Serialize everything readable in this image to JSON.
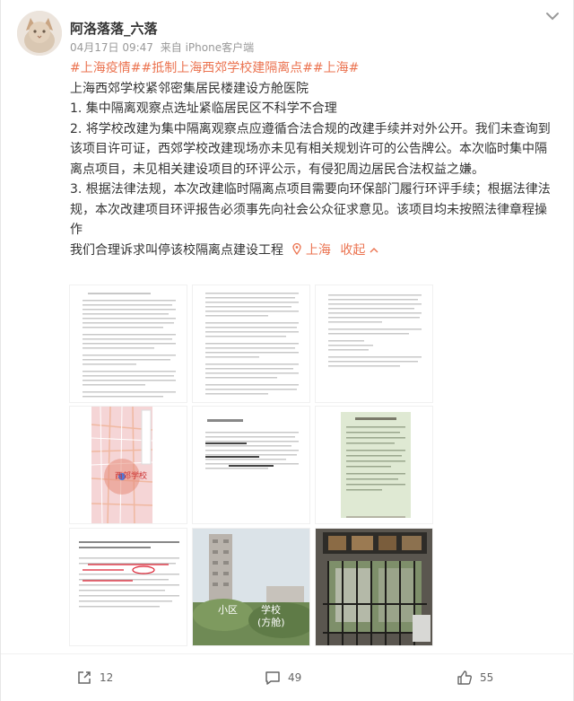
{
  "post": {
    "author": "阿洛落落_六落",
    "date": "04月17日 09:47",
    "source": "来自 iPhone客户端",
    "tags": "#上海疫情##抵制上海西郊学校建隔离点##上海#",
    "lines": [
      "上海西郊学校紧邻密集居民楼建设方舱医院",
      "1. 集中隔离观察点选址紧临居民区不科学不合理",
      "2. 将学校改建为集中隔离观察点应遵循合法合规的改建手续并对外公开。我们未查询到该项目许可证，西郊学校改建现场亦未见有相关规划许可的公告牌公。本次临时集中隔离点项目，未见相关建设项目的环评公示，有侵犯周边居民合法权益之嫌。",
      "3. 根据法律法规，本次改建临时隔离点项目需要向环保部门履行环评手续；根据法律法规，本次改建项目环评报告必须事先向社会公众征求意见。该项目均未按照法律章程操作",
      "我们合理诉求叫停该校隔离点建设工程"
    ],
    "location": "上海",
    "collapse": "收起"
  },
  "images": {
    "map_label": "西郊学校",
    "label_xiaoqu": "小区",
    "label_school_1": "学校",
    "label_school_2": "(方舱)"
  },
  "actions": {
    "share_count": "12",
    "comment_count": "49",
    "like_count": "55"
  },
  "colors": {
    "accent": "#eb7350",
    "meta": "#999999"
  },
  "icons": [
    "more-chevron-icon",
    "location-icon",
    "chevron-up-icon",
    "share-icon",
    "comment-icon",
    "like-icon"
  ]
}
